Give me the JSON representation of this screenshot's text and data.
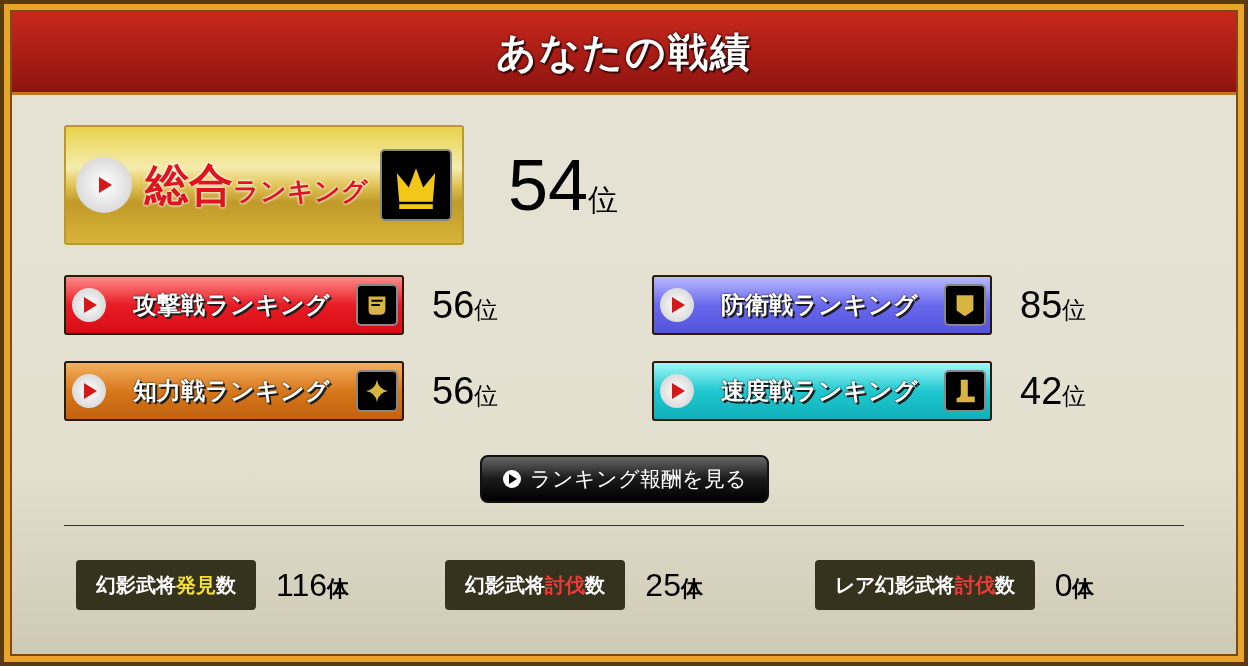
{
  "title": "あなたの戦績",
  "overall": {
    "kind": "overall",
    "label": "総合",
    "label_suffix": "ランキング",
    "rank": "54",
    "unit": "位"
  },
  "rankings": [
    {
      "kind": "attack",
      "label": "攻撃戦ランキング",
      "rank": "56",
      "unit": "位"
    },
    {
      "kind": "defense",
      "label": "防衛戦ランキング",
      "rank": "85",
      "unit": "位"
    },
    {
      "kind": "intellect",
      "label": "知力戦ランキング",
      "rank": "56",
      "unit": "位"
    },
    {
      "kind": "speed",
      "label": "速度戦ランキング",
      "rank": "42",
      "unit": "位"
    }
  ],
  "reward_button": "ランキング報酬を見る",
  "stats": [
    {
      "before": "幻影武将",
      "highlight": "発見",
      "color": "#f2e03a",
      "after": "数",
      "value": "116",
      "unit": "体"
    },
    {
      "before": "幻影武将",
      "highlight": "討伐",
      "color": "#f03a3a",
      "after": "数",
      "value": "25",
      "unit": "体"
    },
    {
      "before": "レア幻影武将",
      "highlight": "討伐",
      "color": "#f03a3a",
      "after": "数",
      "value": "0",
      "unit": "体"
    }
  ]
}
